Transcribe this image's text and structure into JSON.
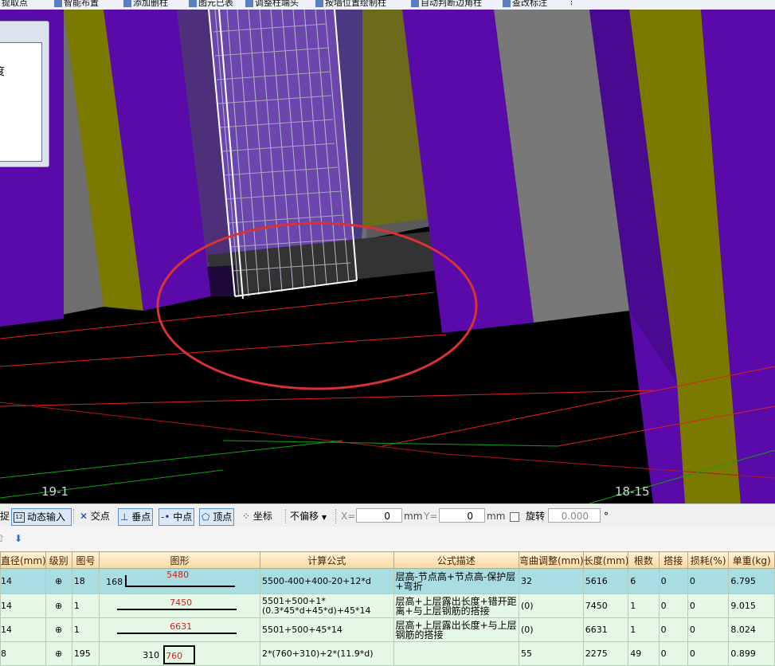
{
  "toolbar": {
    "items": [
      "提取点",
      "智能布置",
      "添加删柱",
      "图元已表",
      "调整柱端头",
      "按墙位置绘制柱",
      "自动判断边角柱",
      "查改标注"
    ]
  },
  "side_panel": {
    "text": "度"
  },
  "viewport": {
    "axis_left": "19-1",
    "axis_right": "18-15"
  },
  "snap_toolbar": {
    "partial_left": "捉",
    "dynamic_input": "动态输入",
    "intersection": "交点",
    "perpendicular": "垂点",
    "midpoint": "中点",
    "vertex": "顶点",
    "coordinate": "坐标",
    "offset_select": "不偏移",
    "x_label": "X=",
    "x_value": "0",
    "y_label": "Y=",
    "y_value": "0",
    "unit1": "mm",
    "unit2": "mm",
    "rotate_label": "旋转",
    "rotate_value": "0.000",
    "degree": "°"
  },
  "table": {
    "headers": [
      "直径(mm)",
      "级别",
      "图号",
      "图形",
      "计算公式",
      "公式描述",
      "弯曲调整(mm)",
      "长度(mm)",
      "根数",
      "搭接",
      "损耗(%)",
      "单重(kg)"
    ],
    "rows": [
      {
        "diameter": "14",
        "grade": "⊕",
        "fig_no": "18",
        "shape_left": "168",
        "shape_value": "5480",
        "formula": "5500-400+400-20+12*d",
        "description": "层高-节点高+节点高-保护层+弯折",
        "bend_adj": "32",
        "length": "5616",
        "count": "6",
        "lap": "0",
        "loss": "0",
        "unit_weight": "6.795"
      },
      {
        "diameter": "14",
        "grade": "⊕",
        "fig_no": "1",
        "shape_left": "",
        "shape_value": "7450",
        "formula": "5501+500+1*(0.3*45*d+45*d)+45*14",
        "description": "层高+上层露出长度+错开距离+与上层钢筋的搭接",
        "bend_adj": "(0)",
        "length": "7450",
        "count": "1",
        "lap": "0",
        "loss": "0",
        "unit_weight": "9.015"
      },
      {
        "diameter": "14",
        "grade": "⊕",
        "fig_no": "1",
        "shape_left": "",
        "shape_value": "6631",
        "formula": "5501+500+45*14",
        "description": "层高+上层露出长度+与上层钢筋的搭接",
        "bend_adj": "(0)",
        "length": "6631",
        "count": "1",
        "lap": "0",
        "loss": "0",
        "unit_weight": "8.024"
      },
      {
        "diameter": "8",
        "grade": "⊕",
        "fig_no": "195",
        "shape_left": "310",
        "shape_value": "760",
        "formula": "2*(760+310)+2*(11.9*d)",
        "description": "",
        "bend_adj": "55",
        "length": "2275",
        "count": "49",
        "lap": "0",
        "loss": "0",
        "unit_weight": "0.899"
      }
    ]
  },
  "colors": {
    "purple": "#5a0aa8",
    "olive": "#7a7a00",
    "gray": "#787878",
    "dark_gray": "#3a3a3a",
    "annotation": "#d03030",
    "table_selected": "#a8dde2",
    "table_row": "#e5f8e5"
  }
}
